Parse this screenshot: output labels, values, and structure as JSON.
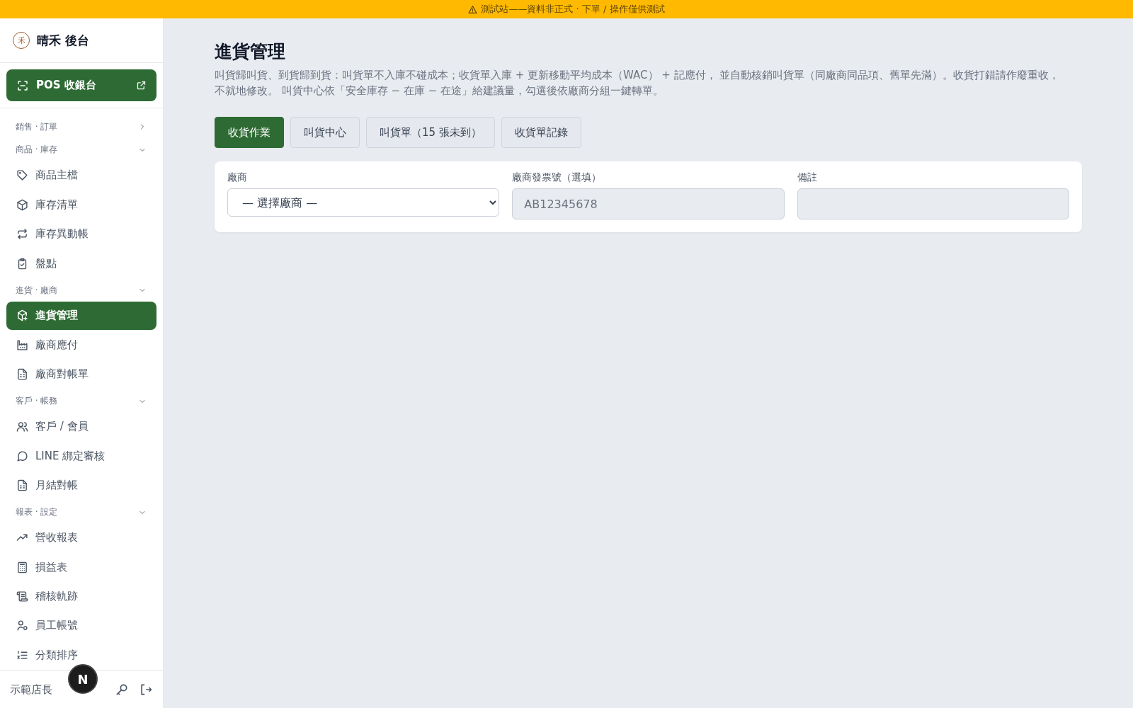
{
  "banner": {
    "text": "測試站——資料非正式 · 下單 / 操作僅供測試"
  },
  "sidebar": {
    "brand": {
      "mark": "禾",
      "title": "晴禾 後台"
    },
    "pos_button": {
      "label": "POS 收銀台"
    },
    "groups": [
      {
        "label": "銷售 · 訂單",
        "expanded": false
      },
      {
        "label": "商品 · 庫存",
        "expanded": true,
        "items": [
          {
            "label": "商品主檔",
            "selected": false
          },
          {
            "label": "庫存清單",
            "selected": false
          },
          {
            "label": "庫存異動帳",
            "selected": false
          },
          {
            "label": "盤點",
            "selected": false
          }
        ]
      },
      {
        "label": "進貨 · 廠商",
        "expanded": true,
        "items": [
          {
            "label": "進貨管理",
            "selected": true
          },
          {
            "label": "廠商應付",
            "selected": false
          },
          {
            "label": "廠商對帳單",
            "selected": false
          }
        ]
      },
      {
        "label": "客戶 · 帳務",
        "expanded": true,
        "items": [
          {
            "label": "客戶 / 會員",
            "selected": false
          },
          {
            "label": "LINE 綁定審核",
            "selected": false
          },
          {
            "label": "月結對帳",
            "selected": false
          }
        ]
      },
      {
        "label": "報表 · 設定",
        "expanded": true,
        "items": [
          {
            "label": "營收報表",
            "selected": false
          },
          {
            "label": "損益表",
            "selected": false
          },
          {
            "label": "稽核軌跡",
            "selected": false
          },
          {
            "label": "員工帳號",
            "selected": false
          },
          {
            "label": "分類排序",
            "selected": false
          }
        ]
      }
    ],
    "footer": {
      "user": "示範店長"
    }
  },
  "dev_badge": {
    "label": "N"
  },
  "page": {
    "title": "進貨管理",
    "description": "叫貨歸叫貨、到貨歸到貨：叫貨單不入庫不碰成本；收貨單入庫 + 更新移動平均成本（WAC） + 記應付， 並自動核銷叫貨單（同廠商同品項、舊單先滿）。收貨打錯請作廢重收，不就地修改。 叫貨中心依「安全庫存 − 在庫 − 在途」給建議量，勾選後依廠商分組一鍵轉單。",
    "tabs": [
      {
        "label": "收貨作業",
        "selected": true
      },
      {
        "label": "叫貨中心",
        "selected": false
      },
      {
        "label": "叫貨單（15 張未到）",
        "selected": false
      },
      {
        "label": "收貨單記錄",
        "selected": false
      }
    ],
    "form": {
      "fields": [
        {
          "kind": "select",
          "label": "廠商",
          "value": "— 選擇廠商 —",
          "disabled": false
        },
        {
          "kind": "input",
          "label": "廠商發票號（選填）",
          "placeholder": "AB12345678",
          "disabled": true
        },
        {
          "kind": "input",
          "label": "備註",
          "disabled": true
        }
      ]
    }
  }
}
